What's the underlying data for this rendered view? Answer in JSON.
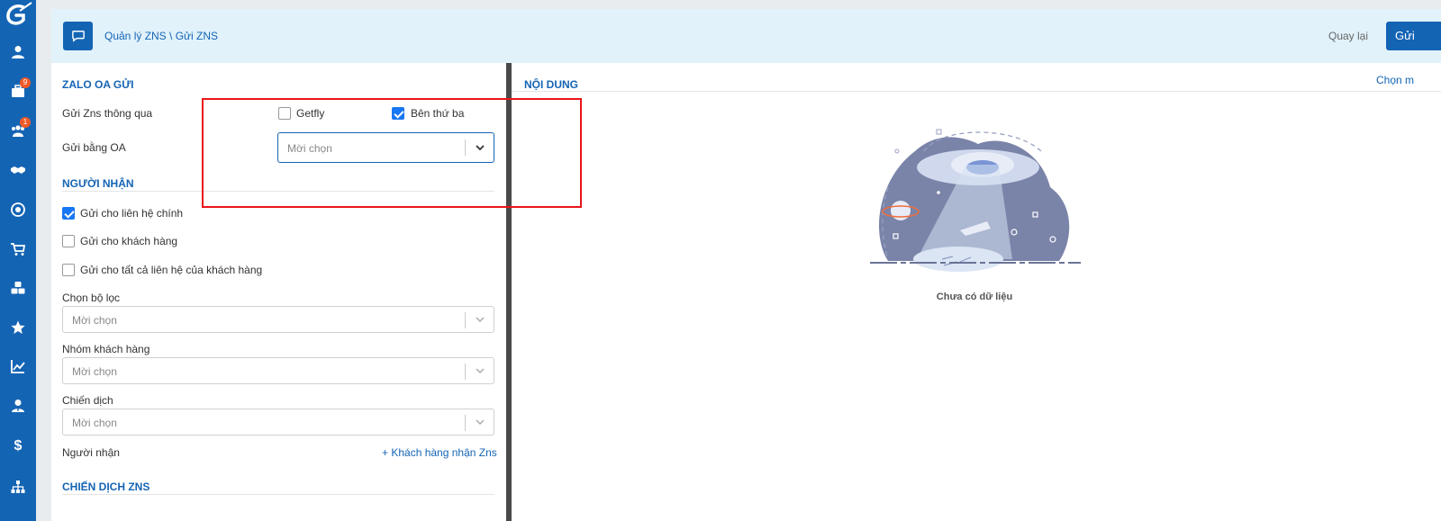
{
  "header": {
    "breadcrumb": "Quản lý ZNS \\ Gửi ZNS",
    "back_label": "Quay lại",
    "send_label": "Gửi"
  },
  "sidebar": {
    "badges": {
      "briefcase": "9",
      "group": "1"
    },
    "icons": [
      "user-icon",
      "briefcase-icon",
      "group-icon",
      "handshake-icon",
      "target-icon",
      "cart-icon",
      "cubes-icon",
      "star-icon",
      "chart-line-icon",
      "user-tie-icon",
      "dollar-icon",
      "sitemap-icon"
    ]
  },
  "left": {
    "zalo_section": "ZALO OA GỬI",
    "send_via_label": "Gửi Zns thông qua",
    "option_getfly": "Getfly",
    "option_third_party": "Bên thứ ba",
    "send_by_oa_label": "Gửi bằng OA",
    "send_by_oa_placeholder": "Mời chọn",
    "recipient_section": "NGƯỜI NHẬN",
    "chk_main_contact": "Gửi cho liên hệ chính",
    "chk_customer": "Gửi cho khách hàng",
    "chk_all_contacts": "Gửi cho tất cả liên hệ của khách hàng",
    "filter_label": "Chọn bộ lọc",
    "filter_placeholder": "Mời chọn",
    "group_label": "Nhóm khách hàng",
    "group_placeholder": "Mời chọn",
    "campaign_label": "Chiến dịch",
    "campaign_placeholder": "Mời chọn",
    "receiver_label": "Người nhận",
    "receiver_link": "+ Khách hàng nhận Zns",
    "zns_campaign_section": "CHIẾN DỊCH ZNS"
  },
  "right": {
    "content_section": "NỘI DUNG",
    "choose_link": "Chọn m",
    "empty_text": "Chưa có dữ liệu"
  },
  "state": {
    "getfly_checked": false,
    "third_party_checked": true,
    "main_contact_checked": true,
    "customer_checked": false,
    "all_contacts_checked": false
  },
  "colors": {
    "primary": "#1464b4",
    "header_bg": "#e1f2fb",
    "badge": "#f05a28",
    "highlight_box": "#e8141b",
    "checkbox_on": "#1877f2"
  }
}
